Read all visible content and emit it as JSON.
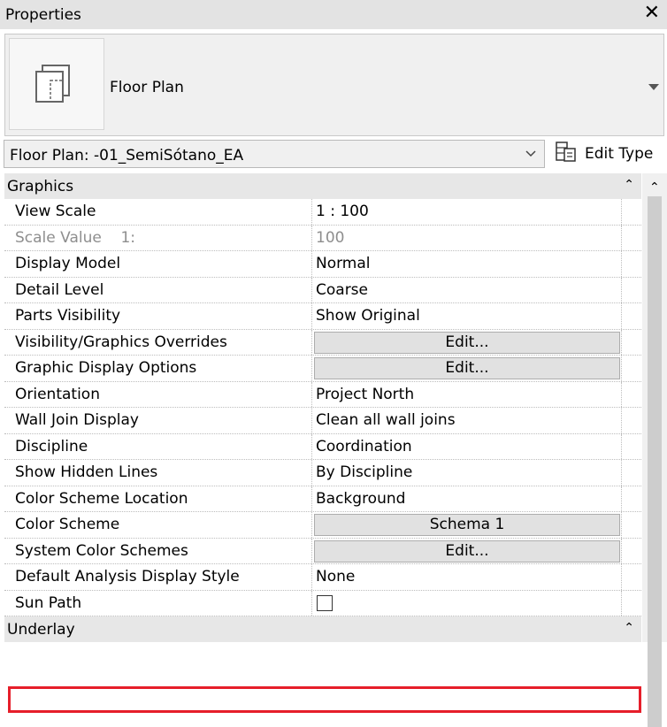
{
  "panel": {
    "title": "Properties",
    "close_icon": "close-icon"
  },
  "type_selector": {
    "name": "Floor Plan"
  },
  "instance": {
    "selected": "Floor Plan: -01_SemiSótano_EA",
    "edit_type_label": "Edit Type"
  },
  "groups": {
    "graphics": "Graphics",
    "underlay": "Underlay"
  },
  "rows": [
    {
      "name": "View Scale",
      "value": "1 : 100",
      "kind": "text"
    },
    {
      "name": "Scale Value    1:",
      "value": "100",
      "kind": "readonly"
    },
    {
      "name": "Display Model",
      "value": "Normal",
      "kind": "text"
    },
    {
      "name": "Detail Level",
      "value": "Coarse",
      "kind": "text"
    },
    {
      "name": "Parts Visibility",
      "value": "Show Original",
      "kind": "text"
    },
    {
      "name": "Visibility/Graphics Overrides",
      "value": "Edit...",
      "kind": "button"
    },
    {
      "name": "Graphic Display Options",
      "value": "Edit...",
      "kind": "button"
    },
    {
      "name": "Orientation",
      "value": "Project North",
      "kind": "text"
    },
    {
      "name": "Wall Join Display",
      "value": "Clean all wall joins",
      "kind": "text"
    },
    {
      "name": "Discipline",
      "value": "Coordination",
      "kind": "text"
    },
    {
      "name": "Show Hidden Lines",
      "value": "By Discipline",
      "kind": "text"
    },
    {
      "name": "Color Scheme Location",
      "value": "Background",
      "kind": "text"
    },
    {
      "name": "Color Scheme",
      "value": "Schema 1",
      "kind": "button"
    },
    {
      "name": "System Color Schemes",
      "value": "Edit...",
      "kind": "button"
    },
    {
      "name": "Default Analysis Display Style",
      "value": "None",
      "kind": "text"
    },
    {
      "name": "Sun Path",
      "value": "",
      "kind": "checkbox",
      "checked": false
    }
  ],
  "colors": {
    "highlight": "#e61e2a",
    "header_bg": "#e3e3e3",
    "group_bg": "#e7e7e7"
  }
}
